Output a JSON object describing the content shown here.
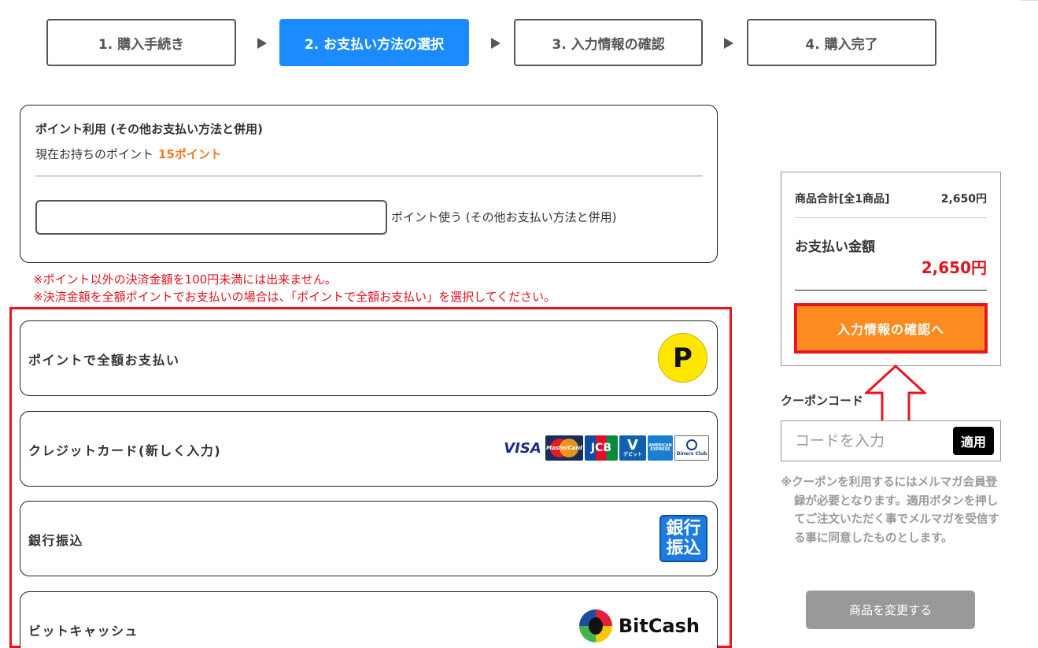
{
  "steps": [
    {
      "label": "1. 購入手続き",
      "active": false
    },
    {
      "label": "2. お支払い方法の選択",
      "active": true
    },
    {
      "label": "3. 入力情報の確認",
      "active": false
    },
    {
      "label": "4. 購入完了",
      "active": false
    }
  ],
  "points": {
    "title": "ポイント利用 (その他お支払い方法と併用)",
    "current_label": "現在お持ちのポイント",
    "current_value": "15ポイント",
    "input_value": "",
    "input_label": "ポイント使う (その他お支払い方法と併用)"
  },
  "notes": [
    "※ポイント以外の決済金額を100円未満には出来ません。",
    "※決済金額を全額ポイントでお支払いの場合は、「ポイントで全額お支払い」を選択してください。"
  ],
  "methods": [
    {
      "label": "ポイントで全額お支払い",
      "icon_text": "P"
    },
    {
      "label": "クレジットカード(新しく入力)",
      "cards": [
        "VISA",
        "MasterCard",
        "JCB",
        "V",
        "AMERICAN EXPRESS",
        "Diners Club"
      ]
    },
    {
      "label": "銀行振込",
      "icon_text": "銀行振込"
    },
    {
      "label": "ビットキャッシュ",
      "icon_text": "BitCash"
    }
  ],
  "card_text": {
    "master": "MasterCard",
    "jcb": "JCB",
    "v_main": "V",
    "v_sub": "デビット",
    "amex": "AMERICAN EXPRESS",
    "diners": "Diners Club"
  },
  "bank_icon": {
    "line1": "銀行",
    "line2": "振込"
  },
  "summary": {
    "subtotal_label": "商品合計[全1商品]",
    "subtotal_value": "2,650円",
    "total_label": "お支払い金額",
    "total_value": "2,650円",
    "confirm_button": "入力情報の確認へ"
  },
  "coupon": {
    "label": "クーポンコード",
    "placeholder": "コードを入力",
    "apply_button": "適用",
    "note": "※クーポンを利用するにはメルマガ会員登録が必要となります。適用ボタンを押してご注文いただく事でメルマガを受信する事に同意したものとします。"
  },
  "change_button": "商品を変更する",
  "colors": {
    "accent_blue": "#1a8cff",
    "orange": "#fd8b21",
    "highlight_red": "#e8141e",
    "point_orange": "#f07c1c"
  }
}
